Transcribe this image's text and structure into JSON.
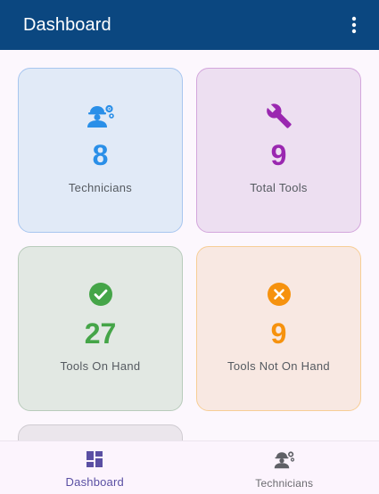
{
  "appbar": {
    "title": "Dashboard",
    "menu_icon": "more-vert-icon",
    "background": "#0b4780"
  },
  "cards": [
    {
      "icon": "technician-icon",
      "value": "8",
      "label": "Technicians",
      "color": "#2a8fe8"
    },
    {
      "icon": "wrench-icon",
      "value": "9",
      "label": "Total Tools",
      "color": "#9a27b0"
    },
    {
      "icon": "check-circle-icon",
      "value": "27",
      "label": "Tools On Hand",
      "color": "#45a548"
    },
    {
      "icon": "cancel-circle-icon",
      "value": "9",
      "label": "Tools Not On Hand",
      "color": "#f6920e"
    }
  ],
  "bottom_nav": {
    "items": [
      {
        "icon": "dashboard-icon",
        "label": "Dashboard",
        "active": true
      },
      {
        "icon": "technician-icon",
        "label": "Technicians",
        "active": false
      }
    ]
  }
}
